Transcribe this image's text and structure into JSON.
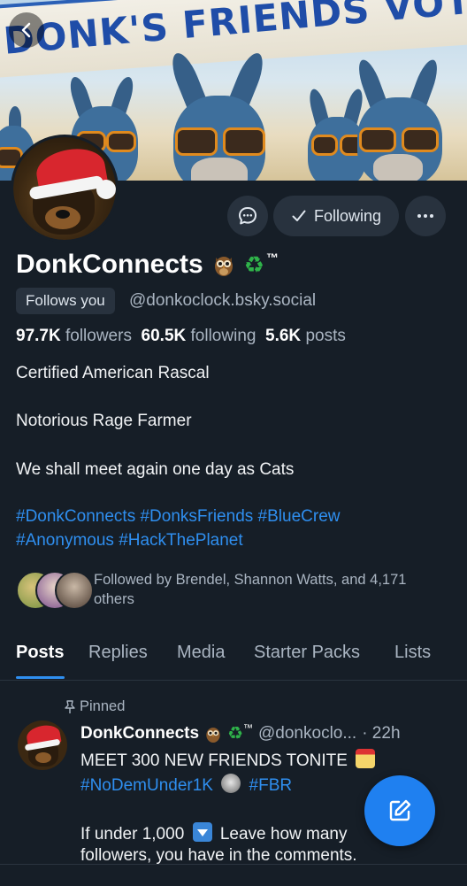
{
  "banner": {
    "text": "DONK'S FRIENDS VOTE BLU"
  },
  "profile": {
    "display_name": "DonkConnects",
    "name_suffix": "™",
    "follows_you_label": "Follows you",
    "handle": "@donkoclock.bsky.social",
    "following_label": "Following",
    "stats": {
      "followers_count": "97.7K",
      "followers_label": "followers",
      "following_count": "60.5K",
      "following_label": "following",
      "posts_count": "5.6K",
      "posts_label": "posts"
    },
    "bio_line1": "Certified American Rascal",
    "bio_line2": "Notorious Rage Farmer",
    "bio_line3": "We shall meet again one day as Cats",
    "hashtags_line1": [
      "#DonkConnects",
      "#DonksFriends",
      "#BlueCrew"
    ],
    "hashtags_line2": [
      "#Anonymous",
      "#HackThePlanet"
    ],
    "followed_by": "Followed by Brendel, Shannon Watts, and 4,171 others"
  },
  "tabs": [
    "Posts",
    "Replies",
    "Media",
    "Starter Packs",
    "Lists"
  ],
  "active_tab": "Posts",
  "post": {
    "pinned_label": "Pinned",
    "author_name": "DonkConnects",
    "author_suffix": "™",
    "author_handle": "@donkoclo...",
    "time": "· 22h",
    "line1": "MEET 300 NEW FRIENDS TONITE",
    "line2_tag1": "#NoDemUnder1K",
    "line2_tag2": "#FBR",
    "line3a": "If under 1,000",
    "line3b": "Leave how many",
    "line4": "followers, you have in the comments."
  },
  "colors": {
    "background": "#161e27",
    "accent": "#2f8ff0",
    "button_bg": "#28323e",
    "fab": "#1f80f0"
  },
  "icons": [
    "back-arrow-icon",
    "message-icon",
    "checkmark-icon",
    "more-icon",
    "owl-emoji-icon",
    "recycle-emoji-icon",
    "pin-icon",
    "slot-machine-emoji-icon",
    "helmet-emoji-icon",
    "down-arrow-emoji-icon",
    "compose-icon"
  ]
}
